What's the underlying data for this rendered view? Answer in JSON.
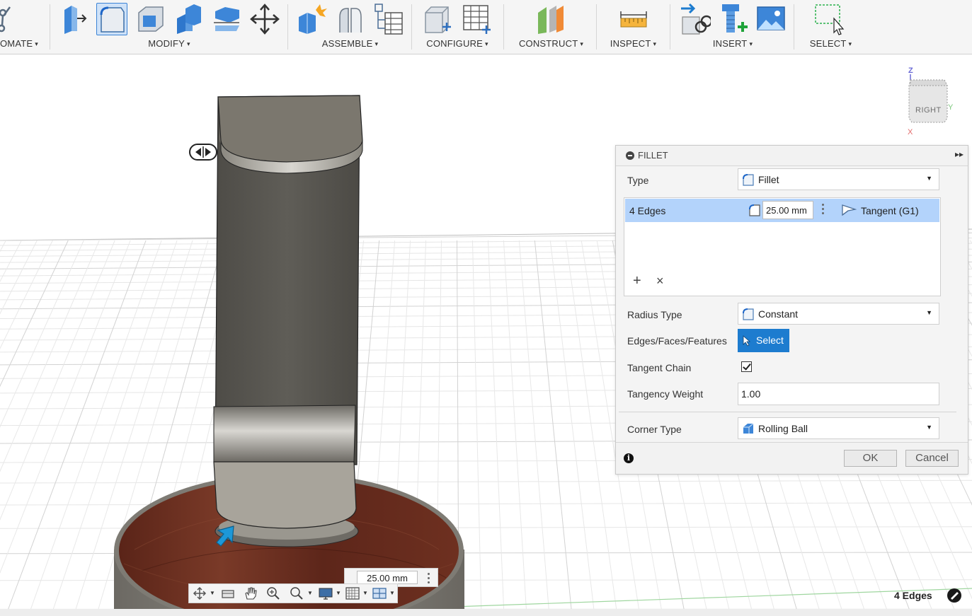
{
  "toolbar": {
    "groups": [
      {
        "label": "AUTOMATE",
        "display": "OMATE"
      },
      {
        "label": "MODIFY"
      },
      {
        "label": "ASSEMBLE"
      },
      {
        "label": "CONFIGURE"
      },
      {
        "label": "CONSTRUCT"
      },
      {
        "label": "INSPECT"
      },
      {
        "label": "INSERT"
      },
      {
        "label": "SELECT"
      }
    ],
    "caret": "▾",
    "active_tool": "fillet-tool",
    "accent_color": "#1d7ccf"
  },
  "viewcube": {
    "face_label": "RIGHT",
    "axis_z": "Z",
    "axis_y": "Y",
    "axis_x": "X"
  },
  "fillet_panel": {
    "title": "FILLET",
    "expand_glyph": "▸▸",
    "type_label": "Type",
    "type_value": "Fillet",
    "edges_label": "4 Edges",
    "radius_value": "25.00 mm",
    "continuity_value": "Tangent (G1)",
    "add_glyph": "+",
    "remove_glyph": "×",
    "radius_type_label": "Radius Type",
    "radius_type_value": "Constant",
    "selection_label": "Edges/Faces/Features",
    "select_button": "Select",
    "tangent_chain_label": "Tangent Chain",
    "tangent_chain_checked": true,
    "tangency_weight_label": "Tangency Weight",
    "tangency_weight_value": "1.00",
    "corner_type_label": "Corner Type",
    "corner_type_value": "Rolling Ball",
    "info_glyph": "i",
    "ok_label": "OK",
    "cancel_label": "Cancel",
    "dropdown_caret": "▼"
  },
  "canvas": {
    "dimension_value": "25.00 mm",
    "status_text": "4 Edges"
  },
  "nav_bar": {
    "items": [
      "orbit-icon",
      "look-at-icon",
      "pan-icon",
      "zoom-icon",
      "zoom-window-icon",
      "display-settings-icon",
      "grid-settings-icon",
      "viewports-icon"
    ]
  }
}
